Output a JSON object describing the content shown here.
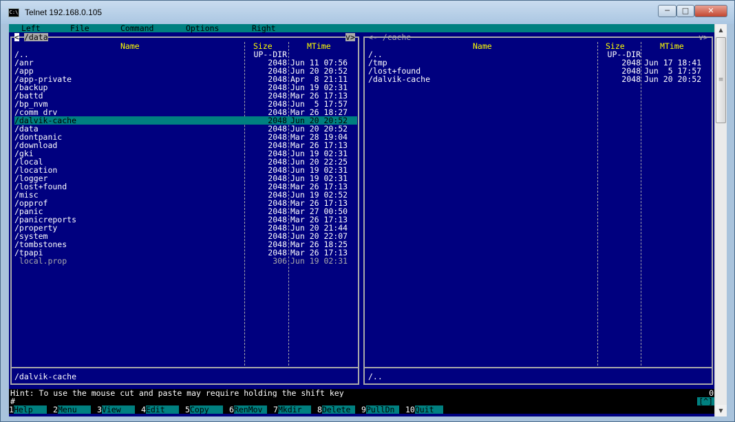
{
  "window": {
    "title": "Telnet 192.168.0.105",
    "icon_label": "C:\\"
  },
  "menubar": {
    "items": [
      "Left",
      "File",
      "Command",
      "Options",
      "Right"
    ]
  },
  "left_panel": {
    "path": " /data ",
    "arrow_left": "<",
    "arrow_right": "v>",
    "headers": {
      "name": "Name",
      "size": "Size",
      "mtime": "MTime"
    },
    "rows": [
      {
        "name": "/..",
        "size": "UP--DIR",
        "mtime": ""
      },
      {
        "name": "/anr",
        "size": "2048",
        "mtime": "Jun 11 07:56"
      },
      {
        "name": "/app",
        "size": "2048",
        "mtime": "Jun 20 20:52"
      },
      {
        "name": "/app-private",
        "size": "2048",
        "mtime": "Apr  8 21:11"
      },
      {
        "name": "/backup",
        "size": "2048",
        "mtime": "Jun 19 02:31"
      },
      {
        "name": "/battd",
        "size": "2048",
        "mtime": "Mar 26 17:13"
      },
      {
        "name": "/bp_nvm",
        "size": "2048",
        "mtime": "Jun  5 17:57"
      },
      {
        "name": "/comm_drv",
        "size": "2048",
        "mtime": "Mar 26 18:27"
      },
      {
        "name": "/dalvik-cache",
        "size": "2048",
        "mtime": "Jun 20 20:52"
      },
      {
        "name": "/data",
        "size": "2048",
        "mtime": "Jun 20 20:52"
      },
      {
        "name": "/dontpanic",
        "size": "2048",
        "mtime": "Mar 28 19:04"
      },
      {
        "name": "/download",
        "size": "2048",
        "mtime": "Mar 26 17:13"
      },
      {
        "name": "/gki",
        "size": "2048",
        "mtime": "Jun 19 02:31"
      },
      {
        "name": "/local",
        "size": "2048",
        "mtime": "Jun 20 22:25"
      },
      {
        "name": "/location",
        "size": "2048",
        "mtime": "Jun 19 02:31"
      },
      {
        "name": "/logger",
        "size": "2048",
        "mtime": "Jun 19 02:31"
      },
      {
        "name": "/lost+found",
        "size": "2048",
        "mtime": "Mar 26 17:13"
      },
      {
        "name": "/misc",
        "size": "2048",
        "mtime": "Jun 19 02:52"
      },
      {
        "name": "/opprof",
        "size": "2048",
        "mtime": "Mar 26 17:13"
      },
      {
        "name": "/panic",
        "size": "2048",
        "mtime": "Mar 27 00:50"
      },
      {
        "name": "/panicreports",
        "size": "2048",
        "mtime": "Mar 26 17:13"
      },
      {
        "name": "/property",
        "size": "2048",
        "mtime": "Jun 20 21:44"
      },
      {
        "name": "/system",
        "size": "2048",
        "mtime": "Jun 20 22:07"
      },
      {
        "name": "/tombstones",
        "size": "2048",
        "mtime": "Mar 26 18:25"
      },
      {
        "name": "/tpapi",
        "size": "2048",
        "mtime": "Mar 26 17:13"
      },
      {
        "name": " local.prop",
        "size": "306",
        "mtime": "Jun 19 02:31"
      }
    ],
    "selected_index": 8,
    "file_index": 25,
    "status": "/dalvik-cache"
  },
  "right_panel": {
    "path": "<- /cache ",
    "arrow_right": "v>",
    "headers": {
      "name": "Name",
      "size": "Size",
      "mtime": "MTime"
    },
    "rows": [
      {
        "name": "/..",
        "size": "UP--DIR",
        "mtime": ""
      },
      {
        "name": "/tmp",
        "size": "2048",
        "mtime": "Jun 17 18:41"
      },
      {
        "name": "/lost+found",
        "size": "2048",
        "mtime": "Jun  5 17:57"
      },
      {
        "name": "/dalvik-cache",
        "size": "2048",
        "mtime": "Jun 20 20:52"
      }
    ],
    "status": "/.."
  },
  "hint": "Hint: To use the mouse cut and paste may require holding the shift key",
  "hint_right": "0",
  "prompt": "#",
  "prompt_right": "[^]",
  "fkeys": [
    {
      "num": "1",
      "label": "Help"
    },
    {
      "num": "2",
      "label": "Menu"
    },
    {
      "num": "3",
      "label": "View"
    },
    {
      "num": "4",
      "label": "Edit"
    },
    {
      "num": "5",
      "label": "Copy"
    },
    {
      "num": "6",
      "label": "RenMov"
    },
    {
      "num": "7",
      "label": "Mkdir"
    },
    {
      "num": "8",
      "label": "Delete"
    },
    {
      "num": "9",
      "label": "PullDn"
    },
    {
      "num": "10",
      "label": "Quit"
    }
  ]
}
